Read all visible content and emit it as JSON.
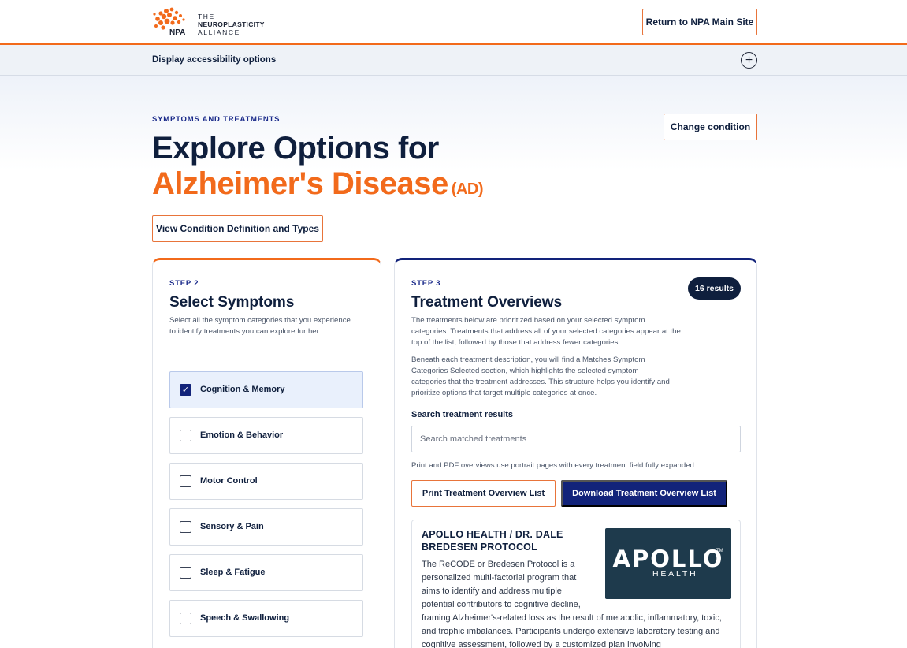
{
  "header": {
    "logo": {
      "brand_line1": "THE",
      "brand_line2": "NEUROPLASTICITY",
      "brand_line3": "ALLIANCE",
      "mark_text": "NPA",
      "icon": "npa-logo-icon"
    },
    "return_button": "Return to NPA Main Site"
  },
  "accessibility": {
    "label": "Display accessibility options",
    "toggle_icon": "plus-circle-icon",
    "toggle_glyph": "+"
  },
  "hero": {
    "eyebrow": "SYMPTOMS AND TREATMENTS",
    "title_line1": "Explore Options for",
    "condition": "Alzheimer's Disease",
    "condition_abbr": "(AD)",
    "change_button": "Change condition",
    "definition_button": "View Condition Definition and Types"
  },
  "symptoms_panel": {
    "step": "STEP 2",
    "title": "Select Symptoms",
    "description": "Select all the symptom categories that you experience to identify treatments you can explore further.",
    "items": [
      {
        "label": "Cognition & Memory",
        "checked": true,
        "check_glyph": "✓"
      },
      {
        "label": "Emotion & Behavior",
        "checked": false
      },
      {
        "label": "Motor Control",
        "checked": false
      },
      {
        "label": "Sensory & Pain",
        "checked": false
      },
      {
        "label": "Sleep & Fatigue",
        "checked": false
      },
      {
        "label": "Speech & Swallowing",
        "checked": false
      }
    ]
  },
  "treatments_panel": {
    "step": "STEP 3",
    "title": "Treatment Overviews",
    "results_badge": "16 results",
    "description1": "The treatments below are prioritized based on your selected symptom categories. Treatments that address all of your selected categories appear at the top of the list, followed by those that address fewer categories.",
    "description2": "Beneath each treatment description, you will find a Matches Symptom Categories Selected section, which highlights the selected symptom categories that the treatment addresses. This structure helps you identify and prioritize options that target multiple categories at once.",
    "search_label": "Search treatment results",
    "search_placeholder": "Search matched treatments",
    "print_note": "Print and PDF overviews use portrait pages with every treatment field fully expanded.",
    "print_button": "Print Treatment Overview List",
    "download_button": "Download Treatment Overview List",
    "first_treatment": {
      "title": "APOLLO HEALTH / DR. DALE BREDESEN PROTOCOL",
      "description_a": "The ReCODE or Bredesen Protocol is a personalized multi-factorial program that aims to identify and address multiple potential contributors to cognitive decline,",
      "description_b": "framing Alzheimer's-related loss as the result of metabolic, inflammatory, toxic, and trophic imbalances. Participants undergo extensive laboratory testing and cognitive assessment, followed by a customized plan involving",
      "logo": {
        "word": "APOLLO",
        "sub": "HEALTH",
        "tm": "TM",
        "icon": "lightbulb-heart-icon"
      }
    }
  },
  "colors": {
    "accent_orange": "#f26a1b",
    "navy": "#12237a",
    "dark_text": "#0f1f3d"
  }
}
